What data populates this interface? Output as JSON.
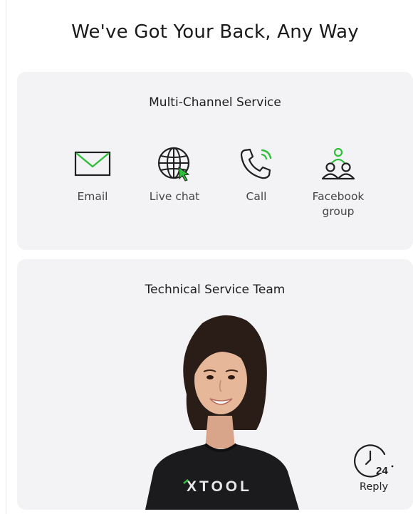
{
  "heading": "We've Got Your Back, Any Way",
  "channels_card": {
    "title": "Multi-Channel Service",
    "items": [
      {
        "label": "Email",
        "icon": "envelope-icon"
      },
      {
        "label": "Live chat",
        "icon": "globe-icon"
      },
      {
        "label": "Call",
        "icon": "phone-icon"
      },
      {
        "label": "Facebook\ngroup",
        "icon": "group-icon"
      }
    ]
  },
  "team_card": {
    "title": "Technical Service Team",
    "shirt_brand": "XTOOL",
    "reply": {
      "badge": "24",
      "label": "Reply",
      "icon": "clock-24-icon"
    }
  },
  "colors": {
    "accent_green": "#2fbf3a",
    "card_bg": "#f3f3f5",
    "icon_stroke": "#1f1f1f"
  }
}
